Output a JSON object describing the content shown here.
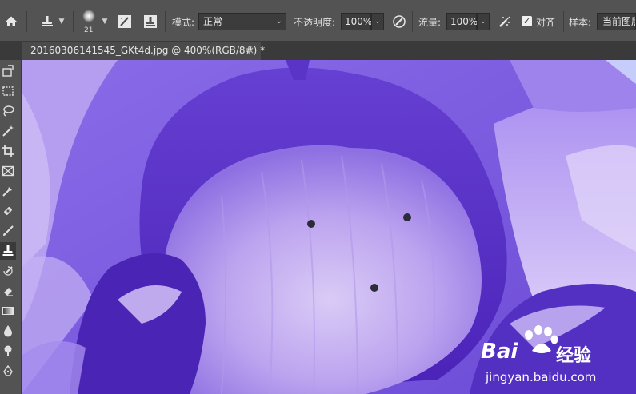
{
  "options_bar": {
    "brush_size": "21",
    "mode_label": "模式:",
    "mode_value": "正常",
    "opacity_label": "不透明度:",
    "opacity_value": "100%",
    "flow_label": "流量:",
    "flow_value": "100%",
    "aligned_label": "对齐",
    "aligned_checked": true,
    "sample_label": "样本:",
    "sample_value": "当前图层"
  },
  "document_tab": {
    "title": "20160306141545_GKt4d.jpg @ 400%(RGB/8#) *",
    "close": "×"
  },
  "toolbar": {
    "tools": [
      "artboard-tool",
      "marquee-tool",
      "lasso-tool",
      "magic-wand-tool",
      "crop-tool",
      "frame-tool",
      "eyedropper-tool",
      "healing-brush-tool",
      "brush-tool",
      "clone-stamp-tool",
      "history-brush-tool",
      "eraser-tool",
      "gradient-tool",
      "blur-tool",
      "dodge-tool",
      "pen-tool"
    ],
    "active_tool": "clone-stamp-tool"
  },
  "watermark": {
    "brand_left": "Bai",
    "brand_right": "经验",
    "url": "jingyan.baidu.com"
  },
  "colors": {
    "ui_panel": "#535353",
    "ui_dark": "#282828",
    "petal_purple": "#7a5ae0",
    "petal_light": "#c7b2f2"
  }
}
